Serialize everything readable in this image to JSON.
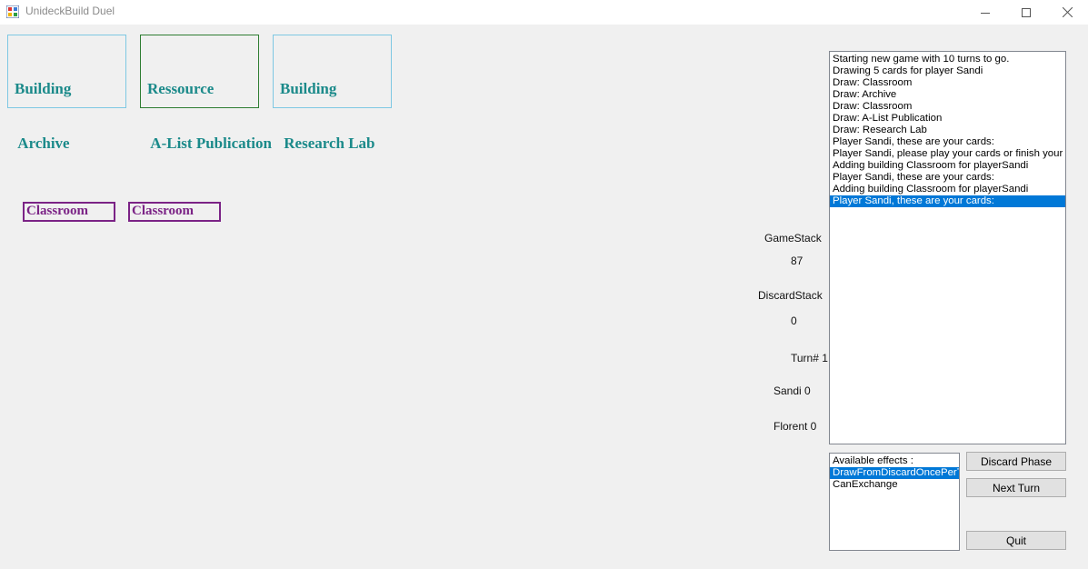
{
  "window": {
    "title": "UnideckBuild Duel",
    "controls": {
      "minimize": "minimize-icon",
      "maximize": "maximize-icon",
      "close": "close-icon"
    }
  },
  "board_cards": [
    {
      "line1": "Building",
      "line2": " Archive",
      "border": "#7ec8e3"
    },
    {
      "line1": "Ressource",
      "line2": " A-List Publication",
      "border": "#2e7d32"
    },
    {
      "line1": "Building",
      "line2": " Research Lab",
      "border": "#7ec8e3"
    }
  ],
  "hand_cards": [
    "Classroom",
    "Classroom"
  ],
  "counters": {
    "game_stack_label": "GameStack",
    "game_stack_value": "87",
    "discard_stack_label": "DiscardStack",
    "discard_stack_value": "0",
    "turn": "Turn# 1",
    "player1": "Sandi 0",
    "player2": "Florent 0"
  },
  "log": {
    "items": [
      "Starting new game with 10 turns to go.",
      "Drawing 5 cards for player Sandi",
      "Draw: Classroom",
      "Draw: Archive",
      "Draw: Classroom",
      "Draw: A-List Publication",
      "Draw: Research Lab",
      "Player Sandi, these are your cards:",
      "Player Sandi, please play your cards or finish your turn",
      "Adding building Classroom for playerSandi",
      "Player Sandi, these are your cards:",
      "Adding building Classroom for playerSandi",
      "Player Sandi, these are your cards:"
    ],
    "selected_index": 12
  },
  "effects": {
    "items": [
      "Available effects :",
      "DrawFromDiscardOncePerTurn",
      "CanExchange"
    ],
    "selected_index": 1
  },
  "buttons": {
    "discard_phase": "Discard Phase",
    "next_turn": "Next Turn",
    "quit": "Quit"
  },
  "colors": {
    "card_text": "#1b8a8a",
    "hand_card": "#7b2386",
    "selection": "#0078d7"
  }
}
